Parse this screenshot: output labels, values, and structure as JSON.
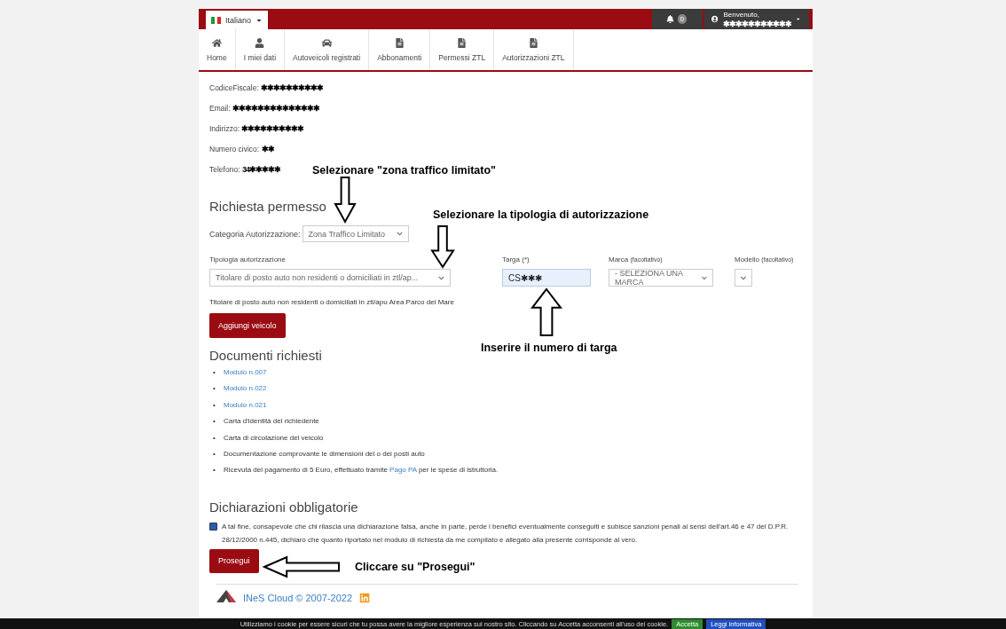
{
  "topbar": {
    "language": "Italiano",
    "notifications": "0",
    "greeting": "Benvenuto,",
    "user_name": "✱✱✱✱✱✱✱✱✱✱✱"
  },
  "nav": [
    {
      "label": "Home"
    },
    {
      "label": "I miei dati"
    },
    {
      "label": "Autoveicoli registrati"
    },
    {
      "label": "Abbonamenti"
    },
    {
      "label": "Permessi ZTL"
    },
    {
      "label": "Autorizzazioni ZTL"
    }
  ],
  "profile": [
    {
      "label": "CodiceFiscale:",
      "value": "✱✱✱✱✱✱✱✱✱✱"
    },
    {
      "label": "Email:",
      "value": "✱✱✱✱✱✱✱✱✱✱✱✱✱✱"
    },
    {
      "label": "Indirizzo:",
      "value": "✱✱✱✱✱✱✱✱✱✱"
    },
    {
      "label": "Numero civico:",
      "value": "✱✱"
    },
    {
      "label": "Telefono:",
      "value": "34✱✱✱✱✱"
    }
  ],
  "request": {
    "title": "Richiesta permesso",
    "category_label": "Categoria Autorizzazione:",
    "category_value": "Zona Traffico Limitato",
    "fields": [
      {
        "kind": "select",
        "label": "Tipologia autorizzazione",
        "value": "Titolare di posto auto non residenti o domiciliati in ztl/ap..."
      },
      {
        "kind": "text",
        "label": "Targa (*)",
        "value": "CS✱✱✱"
      },
      {
        "kind": "select",
        "label": "Marca",
        "hint": "(facoltativo)",
        "value": "- SELEZIONA UNA MARCA"
      },
      {
        "kind": "select",
        "label": "Modello",
        "hint": "(facoltativo)"
      }
    ],
    "description": "Titolare di posto auto non residenti o domiciliati in ztl/apu Area Parco del Mare",
    "button": "Aggiungi veicolo"
  },
  "documents": {
    "title": "Documenti richiesti",
    "marker": "•",
    "items": [
      {
        "kind": "link",
        "text": "Modulo n.007"
      },
      {
        "kind": "link",
        "text": "Modulo n.022"
      },
      {
        "kind": "link",
        "text": "Modulo n.021"
      },
      {
        "kind": "text",
        "text": "Carta d'identità del richiedente"
      },
      {
        "kind": "text",
        "text": "Carta di circolazione del veicolo"
      },
      {
        "kind": "text",
        "text": "Documentazione comprovante le dimensioni del o dei posti auto"
      },
      {
        "kind": "mixed",
        "text": "Ricevuta del pagamento di 5 Euro, effettuato tramite",
        "link": "Pago PA",
        "after": "per le spese di istruttoria."
      }
    ]
  },
  "declarations": {
    "title": "Dichiarazioni obbligatorie",
    "checked": true,
    "text": "A tal fine, consapevole che chi rilascia una dichiarazione falsa, anche in parte, perde i benefici eventualmente conseguiti e subisce sanzioni penali ai sensi dell'art.46 e 47 del D.P.R. 28/12/2000 n.445, dichiaro che quanto riportato nel modulo di richiesta da me compilato e allegato alla presente corrisponde al vero.",
    "button": "Prosegui"
  },
  "footer": {
    "copyright": "INeS Cloud © 2007-2022"
  },
  "cookie_bar": {
    "text": "Utilizziamo i cookie per essere sicuri che tu possa avere la migliore esperienza sul nostro sito. Cliccando su Accetta acconsenti all'uso dei cookie.",
    "accept": "Accetta",
    "info": "Leggi informativa"
  },
  "annotations": [
    {
      "text": "Selezionare \"zona traffico limitato\"",
      "kind": "down"
    },
    {
      "text": "Selezionare la tipologia di autorizzazione",
      "kind": "down"
    },
    {
      "text": "Inserire il numero di targa",
      "kind": "up"
    },
    {
      "text": "Cliccare su \"Prosegui\"",
      "kind": "left"
    }
  ]
}
